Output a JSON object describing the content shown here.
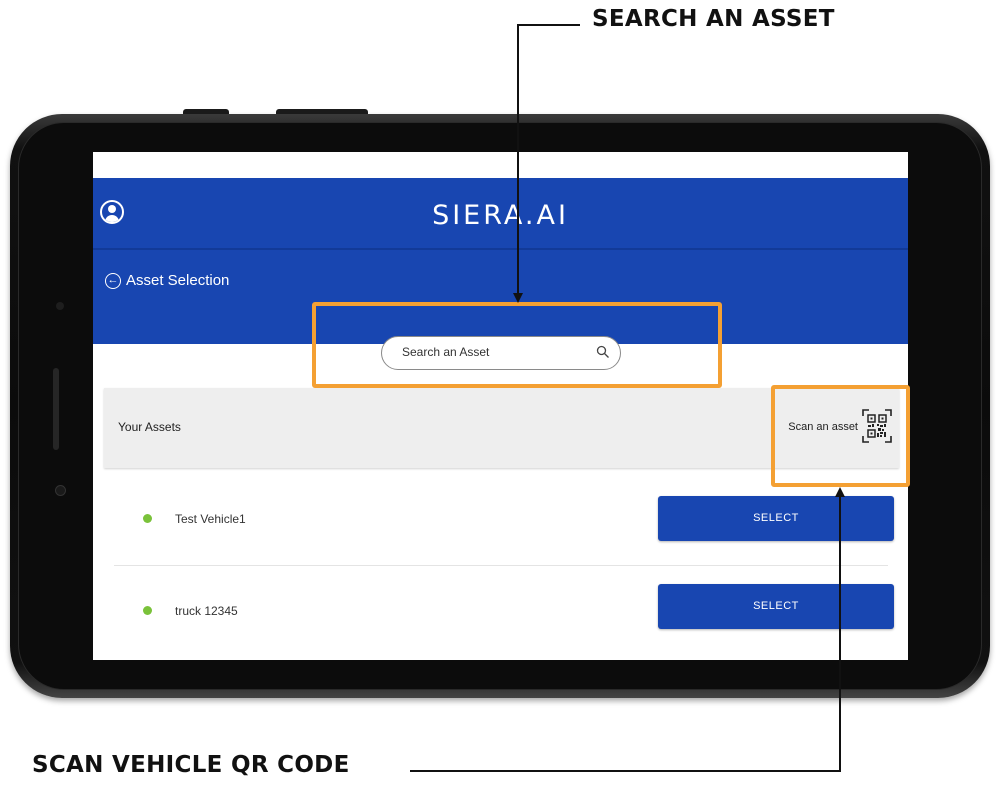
{
  "annotations": {
    "search_callout": "SEARCH AN ASSET",
    "scan_callout": "SCAN VEHICLE QR CODE",
    "highlight_color": "#f4a033"
  },
  "app": {
    "brand": "SIERA.AI",
    "brand_color": "#1846b1",
    "profile_icon": "user-avatar-icon",
    "page_title": "Asset Selection",
    "back_icon": "back-arrow-icon"
  },
  "search": {
    "placeholder": "Search an Asset",
    "icon": "search-icon"
  },
  "assets_panel": {
    "title": "Your Assets",
    "scan_label": "Scan an asset",
    "scan_icon": "qr-code-icon"
  },
  "assets": [
    {
      "name": "Test Vehicle1",
      "status_color": "#7ac23a",
      "action": "SELECT"
    },
    {
      "name": "truck 12345",
      "status_color": "#7ac23a",
      "action": "SELECT"
    }
  ]
}
